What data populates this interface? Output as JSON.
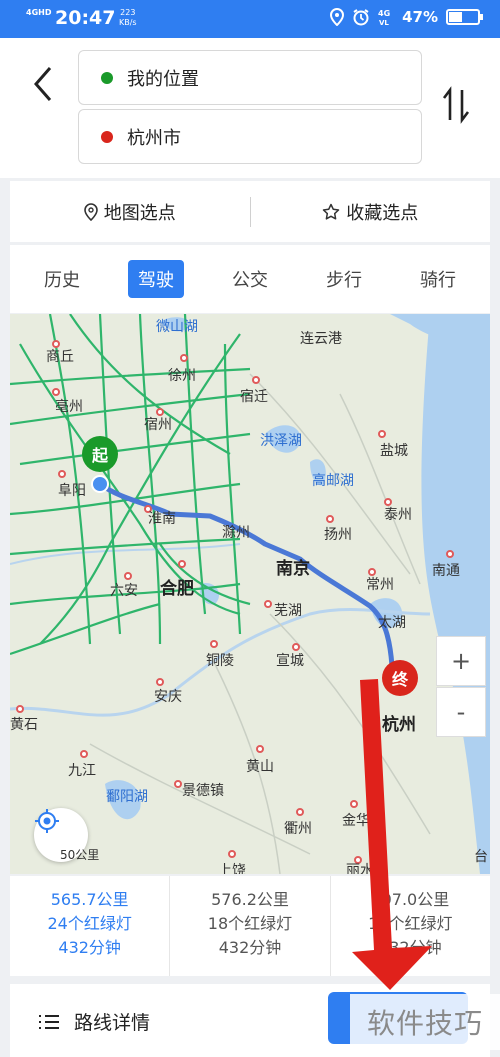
{
  "status": {
    "network": "4GHD",
    "time": "20:47",
    "speed_value": "223",
    "speed_unit": "KB/s",
    "battery_percent": "47%",
    "battery_level": 0.47
  },
  "header": {
    "origin": "我的位置",
    "destination": "杭州市"
  },
  "options": {
    "map_pick": "地图选点",
    "favorite_pick": "收藏选点"
  },
  "tabs": [
    {
      "label": "历史"
    },
    {
      "label": "驾驶"
    },
    {
      "label": "公交"
    },
    {
      "label": "步行"
    },
    {
      "label": "骑行"
    }
  ],
  "map": {
    "labels": {
      "weishan_lake": "微山湖",
      "lianyungang": "连云港",
      "shangqiu": "商丘",
      "xuzhou": "徐州",
      "suqian": "宿迁",
      "bozhou": "亳州",
      "suzhou_ah": "宿州",
      "hongze_lake": "洪泽湖",
      "yancheng": "盐城",
      "gaoyou_lake": "高邮湖",
      "fuyang": "阜阳",
      "huainan": "淮南",
      "chuzhou": "滁州",
      "yangzhou": "扬州",
      "taizhou": "泰州",
      "luan": "六安",
      "hefei": "合肥",
      "nanjing": "南京",
      "changzhou": "常州",
      "nantong": "南通",
      "wuhu": "芜湖",
      "taihu": "太湖",
      "tongling": "铜陵",
      "xuancheng": "宣城",
      "anqing": "安庆",
      "hangzhou": "杭州",
      "huangshi": "黄石",
      "huangshan": "黄山",
      "jiujiang": "九江",
      "poyang_lake": "鄱阳湖",
      "jingdezhen": "景德镇",
      "quzhou": "衢州",
      "jinhua": "金华",
      "shangrao": "上饶",
      "lishui": "丽水",
      "taizhou_zj": "台",
      "scale": "50公里"
    },
    "start_marker": "起",
    "end_marker": "终",
    "zoom_in": "+",
    "zoom_out": "-"
  },
  "routes": [
    {
      "distance": "565.7公里",
      "lights": "24个红绿灯",
      "time": "432分钟"
    },
    {
      "distance": "576.2公里",
      "lights": "18个红绿灯",
      "time": "432分钟"
    },
    {
      "distance": "607.0公里",
      "lights": "19个红绿灯",
      "time": "432分钟"
    }
  ],
  "bottom": {
    "details_label": "路线详情"
  },
  "watermark": "软件技巧",
  "colors": {
    "accent": "#2f7ef1",
    "start": "#1a9a2a",
    "end": "#d9261c",
    "arrow": "#e0211b"
  }
}
